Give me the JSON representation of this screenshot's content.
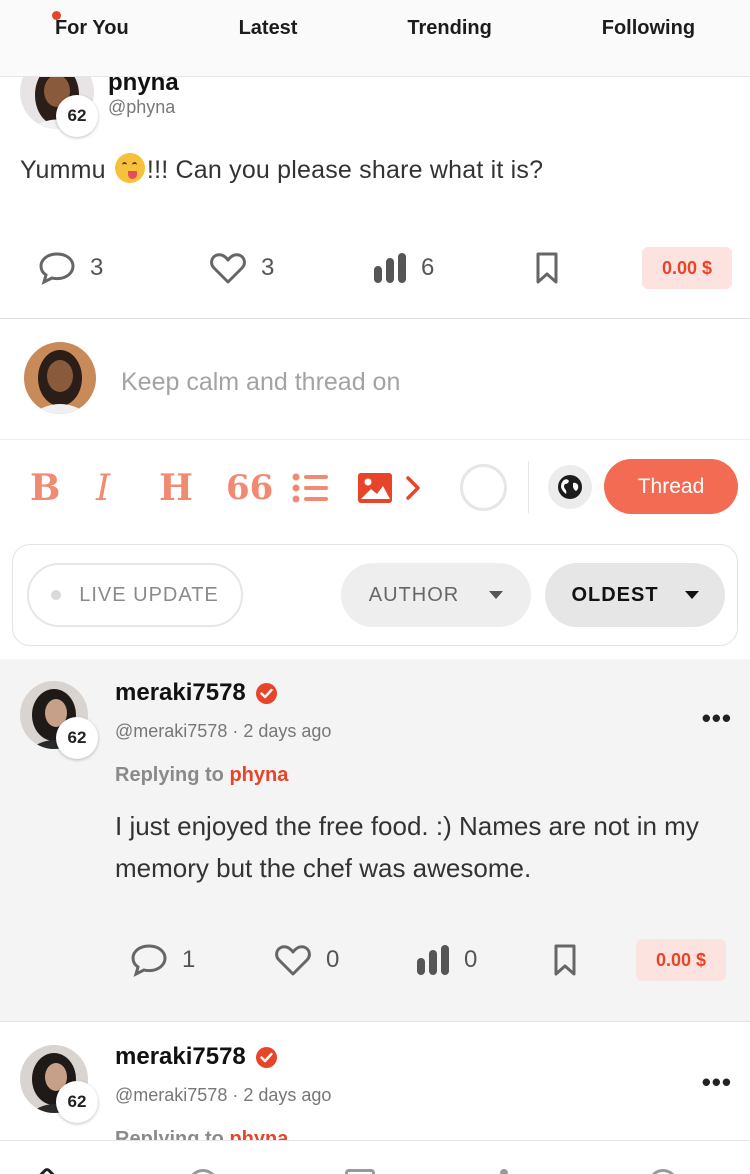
{
  "tabs": [
    {
      "label": "For You",
      "active": true,
      "has_dot": true
    },
    {
      "label": "Latest"
    },
    {
      "label": "Trending"
    },
    {
      "label": "Following"
    }
  ],
  "post": {
    "name": "phyna",
    "handle": "@phyna",
    "badge": "62",
    "text_before": "Yummu",
    "emoji": "savoring-food-emoji",
    "text_after": "!!! Can you please share what it is?",
    "comments": "3",
    "likes": "3",
    "views": "6",
    "tip": "0.00 $"
  },
  "compose": {
    "placeholder": "Keep calm and thread on",
    "toolbar": {
      "bold": "B",
      "italic": "I",
      "heading": "H",
      "quote": "66",
      "thread_button": "Thread"
    }
  },
  "filters": {
    "live": "LIVE UPDATE",
    "author": "AUTHOR",
    "sort": "OLDEST"
  },
  "replies": [
    {
      "name": "meraki7578",
      "handle": "@meraki7578",
      "separator": "·",
      "time": "2 days ago",
      "badge": "62",
      "replying_prefix": "Replying to",
      "replying_to": "phyna",
      "text": "I just enjoyed the free food. :) Names are not in my memory but the chef was awesome.",
      "comments": "1",
      "likes": "0",
      "views": "0",
      "tip": "0.00 $",
      "more": "•••"
    },
    {
      "name": "meraki7578",
      "handle": "@meraki7578",
      "separator": "·",
      "time": "2 days ago",
      "badge": "62",
      "replying_prefix": "Replying to",
      "replying_to": "phyna",
      "more": "•••"
    }
  ],
  "colors": {
    "accent": "#e8442a",
    "thread_button": "#f26b52",
    "tip_bg": "#fde3df",
    "toolbar_icon": "#f08a73"
  }
}
